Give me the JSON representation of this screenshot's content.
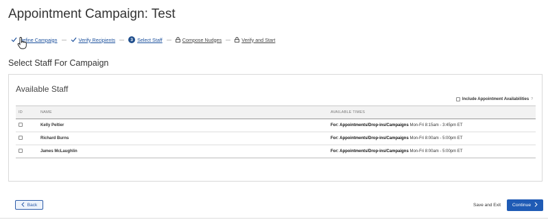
{
  "page": {
    "title": "Appointment Campaign: Test"
  },
  "stepper": {
    "steps": [
      {
        "label": "Define Campaign",
        "state": "done"
      },
      {
        "label": "Verify Recipients",
        "state": "done"
      },
      {
        "number": "3",
        "label": "Select Staff",
        "state": "current"
      },
      {
        "label": "Compose Nudges",
        "state": "locked"
      },
      {
        "label": "Verify and Start",
        "state": "locked"
      }
    ]
  },
  "section": {
    "title": "Select Staff For Campaign"
  },
  "card": {
    "title": "Available Staff",
    "include_label": "Include Appointment Availabilities",
    "include_help": "?"
  },
  "table": {
    "columns": [
      "ID",
      "NAME",
      "AVAILABLE TIMES"
    ],
    "rows": [
      {
        "name": "Kelly Peltier",
        "avail_type": "For: Appointments/Drop-ins/Campaigns",
        "avail_time": "Mon-Fri 8:15am - 3:45pm ET"
      },
      {
        "name": "Richard Burns",
        "avail_type": "For: Appointments/Drop-ins/Campaigns",
        "avail_time": "Mon-Fri 8:00am - 5:00pm ET"
      },
      {
        "name": "James McLaughlin",
        "avail_type": "For: Appointments/Drop-ins/Campaigns",
        "avail_time": "Mon-Fri 8:00am - 5:00pm ET"
      }
    ]
  },
  "footer": {
    "back_label": "Back",
    "save_exit_label": "Save and Exit",
    "continue_label": "Continue"
  },
  "colors": {
    "primary": "#1f5bb5",
    "step_current": "#1f4e8c",
    "link": "#1a4f9c"
  }
}
